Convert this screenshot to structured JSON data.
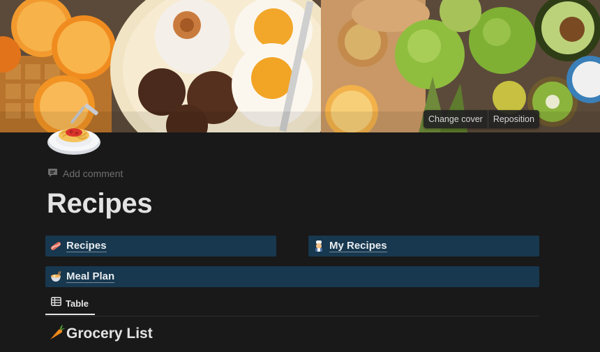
{
  "cover": {
    "change_cover_label": "Change cover",
    "reposition_label": "Reposition"
  },
  "page": {
    "add_comment_label": "Add comment",
    "title": "Recipes"
  },
  "links": [
    {
      "label": "Recipes",
      "icon": "bacon-icon"
    },
    {
      "label": "My Recipes",
      "icon": "cook-icon"
    },
    {
      "label": "Meal Plan",
      "icon": "ramen-bowl-icon"
    }
  ],
  "tabs": [
    {
      "label": "Table",
      "icon": "table-icon",
      "active": true
    }
  ],
  "section": {
    "heading": "Grocery List",
    "icon": "carrot-icon"
  },
  "colors": {
    "background": "#191919",
    "link_block_bg": "#17384f"
  }
}
